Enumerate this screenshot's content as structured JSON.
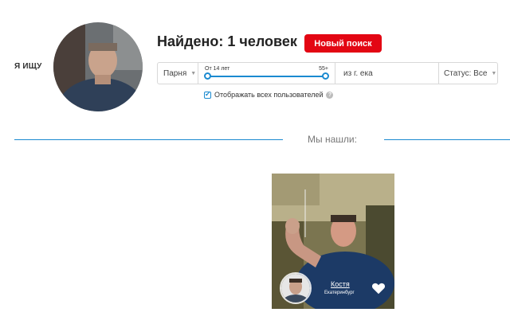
{
  "profile": {
    "seek_label": "Я ИЩУ",
    "avatar_icon": "user-photo"
  },
  "search": {
    "found_text": "Найдено: 1 человек",
    "new_search_label": "Новый поиск",
    "gender_value": "Парня",
    "age_from": "От 14 лет",
    "age_to": "55+",
    "city_value": "из г. ека",
    "status_value": "Статус: Все",
    "show_all_label": "Отображать всех пользователей",
    "show_all_checked": true
  },
  "results": {
    "heading": "Мы нашли:",
    "cards": [
      {
        "name": "Костя",
        "city": "Екатеринбург",
        "like_icon": "heart-icon"
      }
    ]
  },
  "colors": {
    "accent": "#1a8ad0",
    "button_red": "#e30613"
  }
}
